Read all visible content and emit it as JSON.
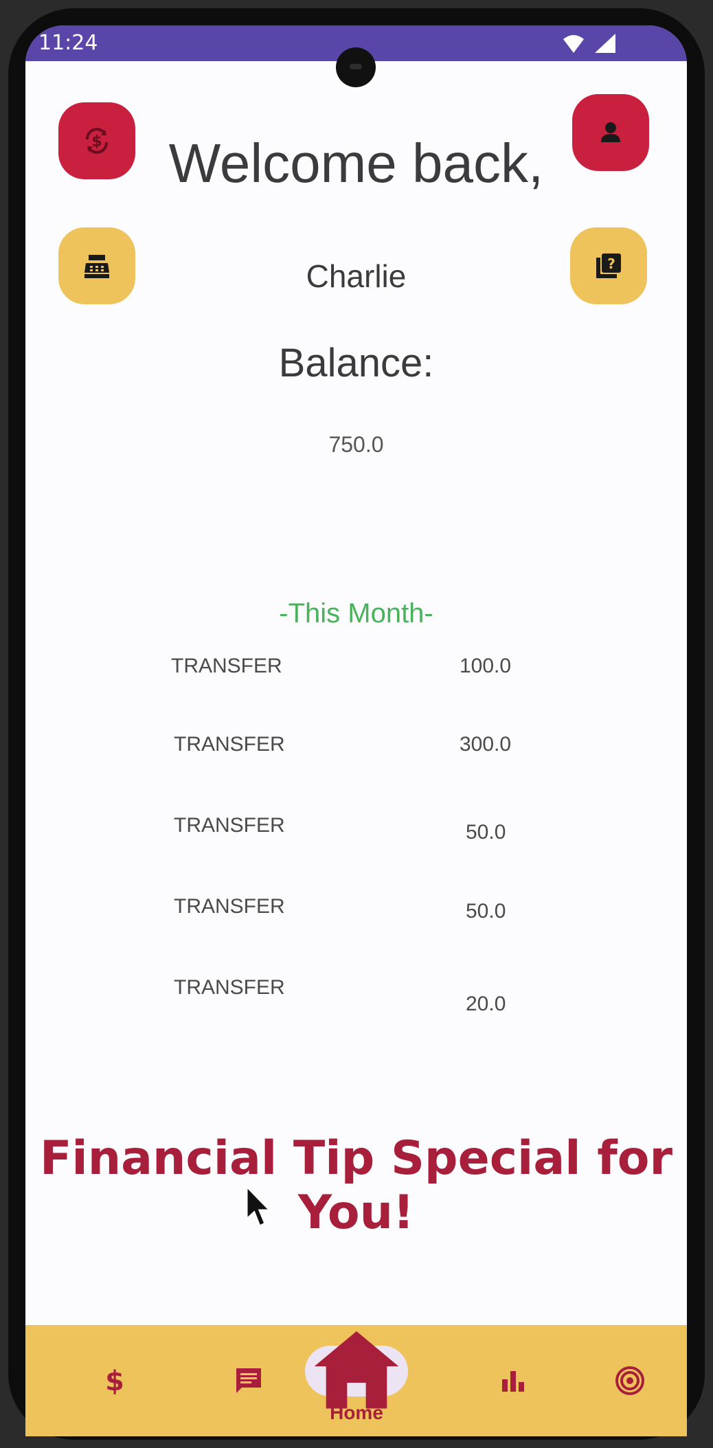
{
  "status_bar": {
    "time": "11:24"
  },
  "header": {
    "welcome": "Welcome back,",
    "username": "Charlie"
  },
  "balance": {
    "label": "Balance:",
    "value": "750.0"
  },
  "transactions": {
    "section_label": "-This Month-",
    "rows": [
      {
        "type": "TRANSFER",
        "amount": "100.0"
      },
      {
        "type": "TRANSFER",
        "amount": "300.0"
      },
      {
        "type": "TRANSFER",
        "amount": "50.0"
      },
      {
        "type": "TRANSFER",
        "amount": "50.0"
      },
      {
        "type": "TRANSFER",
        "amount": "20.0"
      }
    ]
  },
  "tip": {
    "text": "Financial Tip Special for You!"
  },
  "actions": [
    {
      "icon": "currency-exchange-icon"
    },
    {
      "icon": "profile-icon"
    },
    {
      "icon": "cash-register-icon"
    },
    {
      "icon": "quiz-icon"
    }
  ],
  "bottom_nav": {
    "items": [
      {
        "icon": "dollar-icon"
      },
      {
        "icon": "chat-icon"
      },
      {
        "icon": "home-icon",
        "label": "Home",
        "active": true
      },
      {
        "icon": "bar-chart-icon"
      },
      {
        "icon": "target-icon"
      }
    ]
  },
  "colors": {
    "primary_red": "#c8203e",
    "accent_yellow": "#efc35c",
    "status_bar": "#5a46a8",
    "month_green": "#47b35a",
    "tip_red": "#a71f3a"
  }
}
